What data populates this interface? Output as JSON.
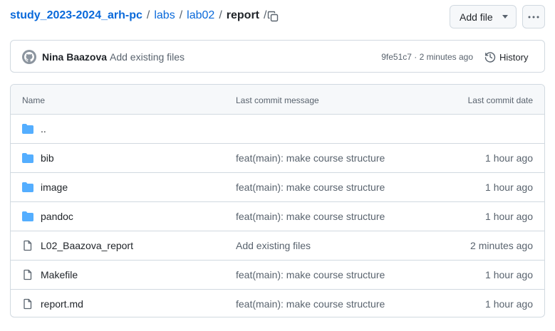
{
  "breadcrumb": {
    "repo": "study_2023-2024_arh-pc",
    "sep1": "/",
    "labs": "labs",
    "sep2": "/",
    "lab02": "lab02",
    "sep3": "/",
    "current": "report",
    "sep4": "/"
  },
  "actions": {
    "add_file_label": "Add file",
    "more_icon": "kebab-horizontal-icon"
  },
  "commit": {
    "author": "Nina Baazova",
    "message": "Add existing files",
    "hash": "9fe51c7",
    "dot": " · ",
    "time": "2 minutes ago",
    "history_label": "History"
  },
  "table": {
    "headers": {
      "name": "Name",
      "message": "Last commit message",
      "date": "Last commit date"
    },
    "rows": [
      {
        "type": "folder",
        "name": "..",
        "message": "",
        "date": ""
      },
      {
        "type": "folder",
        "name": "bib",
        "message": "feat(main): make course structure",
        "date": "1 hour ago"
      },
      {
        "type": "folder",
        "name": "image",
        "message": "feat(main): make course structure",
        "date": "1 hour ago"
      },
      {
        "type": "folder",
        "name": "pandoc",
        "message": "feat(main): make course structure",
        "date": "1 hour ago"
      },
      {
        "type": "file",
        "name": "L02_Baazova_report",
        "message": "Add existing files",
        "date": "2 minutes ago"
      },
      {
        "type": "file",
        "name": "Makefile",
        "message": "feat(main): make course structure",
        "date": "1 hour ago"
      },
      {
        "type": "file",
        "name": "report.md",
        "message": "feat(main): make course structure",
        "date": "1 hour ago"
      }
    ]
  },
  "colors": {
    "link": "#0969da",
    "folder_icon": "#54aeff",
    "file_icon": "#59636e",
    "muted_text": "#59636e",
    "border": "#d1d9e0"
  }
}
